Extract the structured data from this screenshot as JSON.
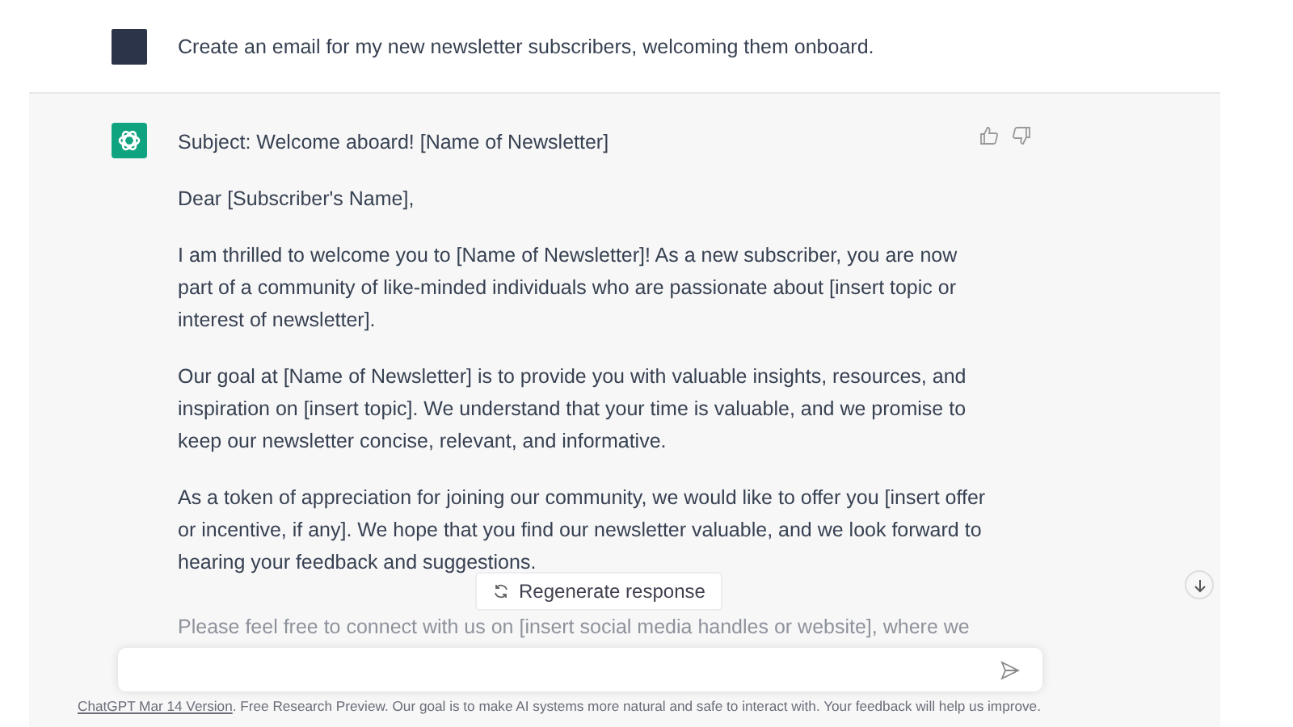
{
  "user_message": {
    "text": "Create an email for my new newsletter subscribers, welcoming them onboard."
  },
  "response": {
    "paragraphs": [
      "Subject: Welcome aboard! [Name of Newsletter]",
      "Dear [Subscriber's Name],",
      "I am thrilled to welcome you to [Name of Newsletter]! As a new subscriber, you are now part of a community of like-minded individuals who are passionate about [insert topic or interest of newsletter].",
      "Our goal at [Name of Newsletter] is to provide you with valuable insights, resources, and inspiration on [insert topic]. We understand that your time is valuable, and we promise to keep our newsletter concise, relevant, and informative.",
      "As a token of appreciation for joining our community, we would like to offer you [insert offer or incentive, if any]. We hope that you find our newsletter valuable, and we look forward to hearing your feedback and suggestions."
    ],
    "cut_off_paragraph": "Please feel free to connect with us on [insert social media handles or website], where we"
  },
  "regenerate_button": {
    "label": "Regenerate response"
  },
  "footer": {
    "link": "ChatGPT Mar 14 Version",
    "text": ". Free Research Preview. Our goal is to make AI systems more natural and safe to interact with. Your feedback will help us improve."
  }
}
